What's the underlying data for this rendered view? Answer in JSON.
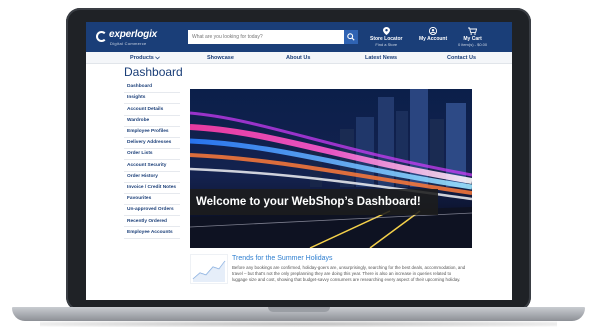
{
  "header": {
    "logo": "experlogix",
    "logo_sub": "Digital Commerce",
    "search_placeholder": "What are you looking for today?",
    "store_locator": {
      "main": "Store Locator",
      "sub": "Find a Store"
    },
    "my_account": {
      "main": "My Account"
    },
    "my_cart": {
      "main": "My Cart",
      "sub": "0 item(s) - $0.00"
    }
  },
  "nav": {
    "products": "Products",
    "showcase": "Showcase",
    "about": "About Us",
    "news": "Latest News",
    "contact": "Contact Us"
  },
  "page_title": "Dashboard",
  "sidebar": {
    "items": [
      "Dashboard",
      "Insights",
      "Account Details",
      "Wardrobe",
      "Employee Profiles",
      "Delivery Addresses",
      "Order Lists",
      "Account Security",
      "Order History",
      "Invoice / Credit Notes",
      "Favourites",
      "Un-approved Orders",
      "Recently Ordered",
      "Employee Accounts"
    ]
  },
  "hero": {
    "text": "Welcome to your WebShop’s Dashboard!"
  },
  "article": {
    "title": "Trends for the Summer Holidays",
    "body": "Before any bookings are confirmed, holiday-goers are, unsurprisingly, searching for the best deals, accommodation, and travel – but that's not the only preplanning they are doing this year. There is also an increase in queries related to luggage size and cost, showing that budget-savvy consumers are researching every aspect of their upcoming holiday."
  },
  "colors": {
    "brand": "#1a3e78",
    "accent": "#2f63b3",
    "link": "#2f7fd0"
  }
}
